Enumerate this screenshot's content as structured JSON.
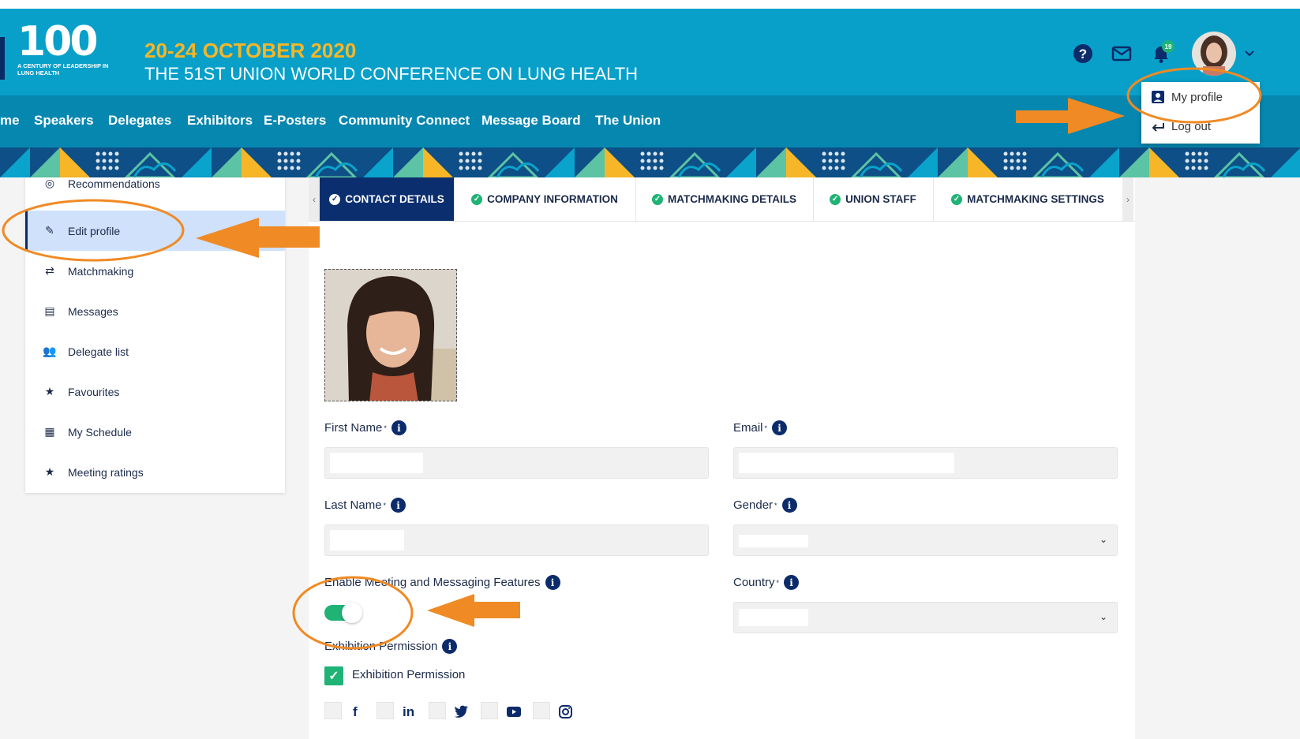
{
  "header": {
    "logo_number": "100",
    "logo_tagline": "A CENTURY OF LEADERSHIP IN LUNG HEALTH",
    "conference_date": "20-24 OCTOBER 2020",
    "conference_title": "THE 51ST UNION WORLD CONFERENCE ON LUNG HEALTH",
    "notification_count": "19",
    "icons": [
      "help-icon",
      "mail-icon",
      "bell-icon",
      "avatar",
      "chevron-down-icon"
    ]
  },
  "nav": {
    "items": [
      "me",
      "Speakers",
      "Delegates",
      "Exhibitors",
      "E-Posters",
      "Community Connect",
      "Message Board",
      "The Union"
    ]
  },
  "user_menu": {
    "items": [
      "My profile",
      "Log out"
    ]
  },
  "sidebar": {
    "items": [
      {
        "label": "Recommendations",
        "icon": "target-icon"
      },
      {
        "label": "Edit profile",
        "icon": "pencil-icon"
      },
      {
        "label": "Matchmaking",
        "icon": "swap-icon"
      },
      {
        "label": "Messages",
        "icon": "message-icon"
      },
      {
        "label": "Delegate list",
        "icon": "people-icon"
      },
      {
        "label": "Favourites",
        "icon": "star-icon"
      },
      {
        "label": "My Schedule",
        "icon": "calendar-icon"
      },
      {
        "label": "Meeting ratings",
        "icon": "star-icon"
      }
    ]
  },
  "tabs": {
    "items": [
      "CONTACT DETAILS",
      "COMPANY INFORMATION",
      "MATCHMAKING DETAILS",
      "UNION STAFF",
      "MATCHMAKING SETTINGS"
    ]
  },
  "form": {
    "first_name_label": "First Name",
    "email_label": "Email",
    "last_name_label": "Last Name",
    "gender_label": "Gender",
    "meeting_label": "Enable Meeting and Messaging Features",
    "country_label": "Country",
    "exhibition_label": "Exhibition Permission",
    "exhibition_checkbox_label": "Exhibition Permission",
    "required_mark": "*",
    "info_glyph": "i"
  },
  "social": {
    "icons": [
      "f",
      "in",
      "twitter-icon",
      "youtube-icon",
      "instagram-icon"
    ]
  },
  "colors": {
    "header_bg": "#08a0c9",
    "nav_bg": "#0687b0",
    "accent_yellow": "#f6b628",
    "navy": "#0b2f6e",
    "green": "#1fb376",
    "annotation_orange": "#f08a24"
  }
}
